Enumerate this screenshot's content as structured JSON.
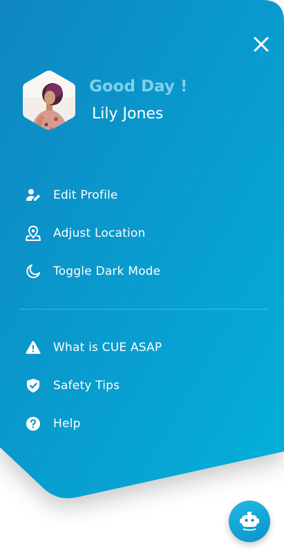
{
  "header": {
    "greeting": "Good Day !",
    "user_name": "Lily Jones"
  },
  "menu_primary": [
    {
      "label": "Edit Profile",
      "icon": "user-edit-icon"
    },
    {
      "label": "Adjust Location",
      "icon": "location-pin-icon"
    },
    {
      "label": "Toggle Dark Mode",
      "icon": "moon-icon"
    }
  ],
  "menu_secondary": [
    {
      "label": "What is CUE ASAP",
      "icon": "warning-icon"
    },
    {
      "label": "Safety Tips",
      "icon": "shield-check-icon"
    },
    {
      "label": "Help",
      "icon": "help-circle-icon"
    }
  ],
  "colors": {
    "gradient_start": "#0f86c1",
    "gradient_end": "#03b0da",
    "greeting": "#7fd0ea",
    "text": "#ffffff"
  }
}
